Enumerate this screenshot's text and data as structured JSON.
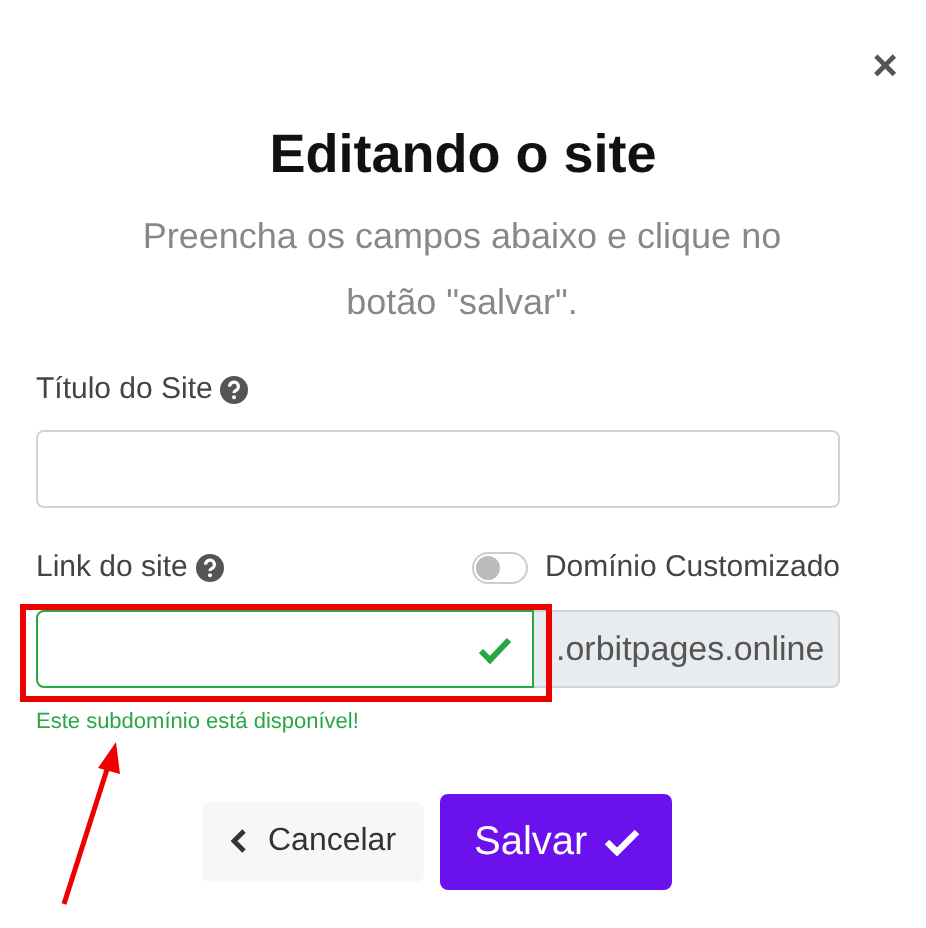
{
  "close": "×",
  "title": "Editando o site",
  "subtitle": "Preencha os campos abaixo e clique no botão \"salvar\".",
  "site_title_field": {
    "label": "Título do Site"
  },
  "link_field": {
    "label": "Link do site",
    "valid": true,
    "addon": ".orbitpages.online",
    "feedback": "Este subdomínio está disponível!",
    "highlighted": true
  },
  "custom_domain_switch": {
    "label": "Domínio Customizado",
    "on": false
  },
  "buttons": [
    {
      "kind": "cancel",
      "label": "Cancelar"
    },
    {
      "kind": "save",
      "label": "Salvar"
    }
  ]
}
